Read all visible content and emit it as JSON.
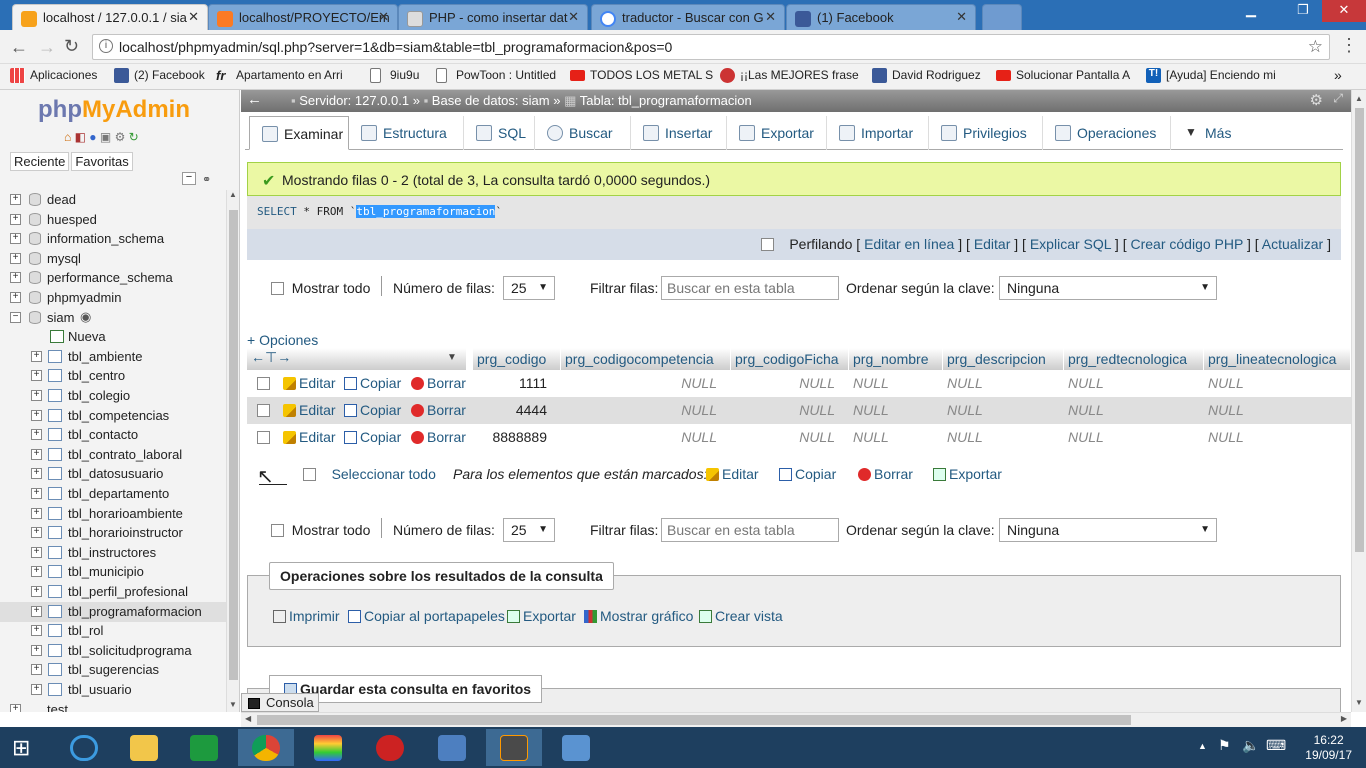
{
  "browser": {
    "tabs": [
      {
        "label": "localhost / 127.0.0.1 / sia",
        "active": true,
        "icon": "phpmyadmin-icon"
      },
      {
        "label": "localhost/PROYECTO/Em",
        "active": false,
        "icon": "xampp-icon"
      },
      {
        "label": "PHP - como insertar dat",
        "active": false,
        "icon": "page-icon"
      },
      {
        "label": "traductor - Buscar con G",
        "active": false,
        "icon": "google-icon"
      },
      {
        "label": "(1) Facebook",
        "active": false,
        "icon": "facebook-icon"
      }
    ],
    "url": "localhost/phpmyadmin/sql.php?server=1&db=siam&table=tbl_programaformacion&pos=0",
    "bookmarks": [
      {
        "label": "Aplicaciones",
        "icon": "apps-icon"
      },
      {
        "label": "(2) Facebook",
        "icon": "facebook-icon"
      },
      {
        "label": "Apartamento en Arri",
        "icon": "fr-icon"
      },
      {
        "label": "9iu9u",
        "icon": "page-icon"
      },
      {
        "label": "PowToon : Untitled",
        "icon": "page-icon"
      },
      {
        "label": "TODOS LOS METAL S",
        "icon": "youtube-icon"
      },
      {
        "label": "¡¡Las MEJORES frase",
        "icon": "bomb-icon"
      },
      {
        "label": "David Rodriguez",
        "icon": "facebook-icon"
      },
      {
        "label": "Solucionar Pantalla A",
        "icon": "youtube-icon"
      },
      {
        "label": "[Ayuda] Enciendo mi",
        "icon": "t-icon"
      }
    ],
    "more": "»"
  },
  "nav": {
    "logo_php": "php",
    "logo_myadmin": "MyAdmin",
    "tab_recent": "Reciente",
    "tab_favorites": "Favoritas",
    "databases_top": [
      "dead",
      "huesped",
      "information_schema",
      "mysql",
      "performance_schema",
      "phpmyadmin",
      "siam"
    ],
    "new_label": "Nueva",
    "tables": [
      "tbl_ambiente",
      "tbl_centro",
      "tbl_colegio",
      "tbl_competencias",
      "tbl_contacto",
      "tbl_contrato_laboral",
      "tbl_datosusuario",
      "tbl_departamento",
      "tbl_horarioambiente",
      "tbl_horarioinstructor",
      "tbl_instructores",
      "tbl_municipio",
      "tbl_perfil_profesional",
      "tbl_programaformacion",
      "tbl_rol",
      "tbl_solicitudprograma",
      "tbl_sugerencias",
      "tbl_usuario"
    ],
    "selected_table": "tbl_programaformacion",
    "last_db": "test"
  },
  "breadcrumb": {
    "server": "Servidor: 127.0.0.1",
    "database": "Base de datos: siam",
    "table": "Tabla: tbl_programaformacion"
  },
  "menu": [
    {
      "label": "Examinar",
      "active": true
    },
    {
      "label": "Estructura"
    },
    {
      "label": "SQL"
    },
    {
      "label": "Buscar"
    },
    {
      "label": "Insertar"
    },
    {
      "label": "Exportar"
    },
    {
      "label": "Importar"
    },
    {
      "label": "Privilegios"
    },
    {
      "label": "Operaciones"
    },
    {
      "label": "Más"
    }
  ],
  "success_message": "Mostrando filas 0 - 2 (total de 3, La consulta tardó 0,0000 segundos.)",
  "sql": {
    "keyword1": "SELECT",
    "rest": " * FROM `",
    "table": "tbl_programaformacion",
    "end": "`"
  },
  "profiling": {
    "label": "Perfilando",
    "links": [
      "Editar en línea",
      "Editar",
      "Explicar SQL",
      "Crear código PHP",
      "Actualizar"
    ]
  },
  "nav_controls": {
    "show_all": "Mostrar todo",
    "rows_label": "Número de filas:",
    "rows_value": "25",
    "filter_label": "Filtrar filas:",
    "filter_placeholder": "Buscar en esta tabla",
    "sort_label": "Ordenar según la clave:",
    "sort_value": "Ninguna"
  },
  "options_link": "+ Opciones",
  "grid": {
    "columns": [
      "prg_codigo",
      "prg_codigocompetencia",
      "prg_codigoFicha",
      "prg_nombre",
      "prg_descripcion",
      "prg_redtecnologica",
      "prg_lineatecnologica"
    ],
    "actions": {
      "edit": "Editar",
      "copy": "Copiar",
      "delete": "Borrar"
    },
    "rows": [
      [
        "1111",
        "NULL",
        "NULL",
        "NULL",
        "NULL",
        "NULL",
        "NULL"
      ],
      [
        "4444",
        "NULL",
        "NULL",
        "NULL",
        "NULL",
        "NULL",
        "NULL"
      ],
      [
        "8888889",
        "NULL",
        "NULL",
        "NULL",
        "NULL",
        "NULL",
        "NULL"
      ]
    ]
  },
  "bulk": {
    "select_all": "Seleccionar todo",
    "marked_label": "Para los elementos que están marcados:",
    "edit": "Editar",
    "copy": "Copiar",
    "delete": "Borrar",
    "export": "Exportar"
  },
  "query_ops": {
    "legend": "Operaciones sobre los resultados de la consulta",
    "print": "Imprimir",
    "copy_clipboard": "Copiar al portapapeles",
    "export": "Exportar",
    "chart": "Mostrar gráfico",
    "create_view": "Crear vista"
  },
  "bookmark_legend": "Guardar esta consulta en favoritos",
  "console_label": "Consola",
  "clock": {
    "time": "16:22",
    "date": "19/09/17"
  },
  "colors": {
    "accent": "#235a81",
    "success_bg": "#ebf8a4",
    "taskbar": "#1e3f5f"
  }
}
